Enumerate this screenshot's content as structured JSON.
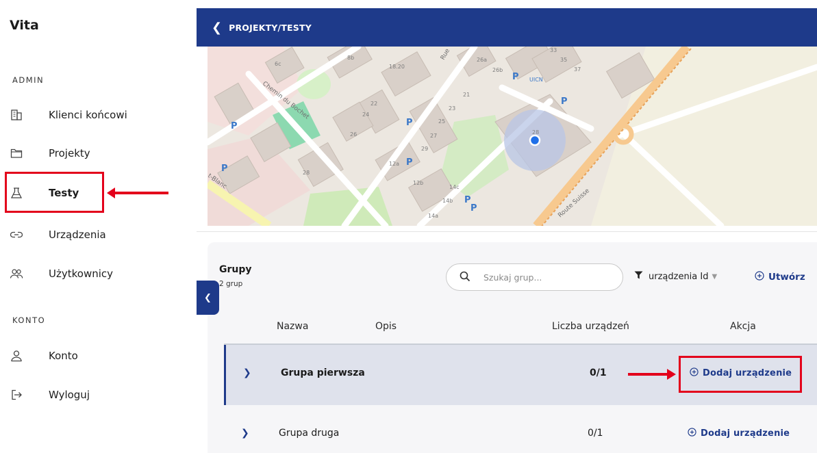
{
  "app": {
    "brand": "Vita"
  },
  "sidebar": {
    "sections": [
      {
        "label": "ADMIN"
      },
      {
        "label": "KONTO"
      }
    ],
    "items": [
      {
        "label": "Klienci końcowi",
        "icon": "building-icon"
      },
      {
        "label": "Projekty",
        "icon": "folder-icon"
      },
      {
        "label": "Testy",
        "icon": "flask-icon"
      },
      {
        "label": "Urządzenia",
        "icon": "link-icon"
      },
      {
        "label": "Użytkownicy",
        "icon": "users-icon"
      },
      {
        "label": "Konto",
        "icon": "user-icon"
      },
      {
        "label": "Wyloguj",
        "icon": "logout-icon"
      }
    ],
    "active_item": "Testy"
  },
  "header": {
    "back_icon": "chevron-left-icon",
    "breadcrumb": "PROJEKTY/TESTY"
  },
  "map": {
    "labels": {
      "street_1": "Chemin du Bochet",
      "street_2": "Route Suisse",
      "street_3": "Rue",
      "street_4": "t-Blanc",
      "poi": "UICN",
      "numbers": [
        "6c",
        "8b",
        "18.20",
        "26a",
        "26b",
        "33",
        "35",
        "37",
        "22",
        "24",
        "26",
        "21",
        "23",
        "25",
        "27",
        "29",
        "12a",
        "12b",
        "14c",
        "14b",
        "14a",
        "28",
        "28",
        "P",
        "1"
      ]
    }
  },
  "groups": {
    "title": "Grupy",
    "count_text": "2 grup",
    "collapse_icon": "chevron-left-icon",
    "search": {
      "placeholder": "Szukaj grup..."
    },
    "filter": {
      "label": "urządzenia Id"
    },
    "create_label": "Utwórz",
    "columns": [
      "Nazwa",
      "Opis",
      "Liczba urządzeń",
      "Akcja"
    ],
    "rows": [
      {
        "name": "Grupa pierwsza",
        "count": "0/1",
        "action": "Dodaj urządzenie"
      },
      {
        "name": "Grupa druga",
        "count": "0/1",
        "action": "Dodaj urządzenie"
      }
    ]
  },
  "colors": {
    "accent": "#1e3a8a",
    "highlight_red": "#e3001b",
    "selected_row": "#dfe2ec"
  }
}
